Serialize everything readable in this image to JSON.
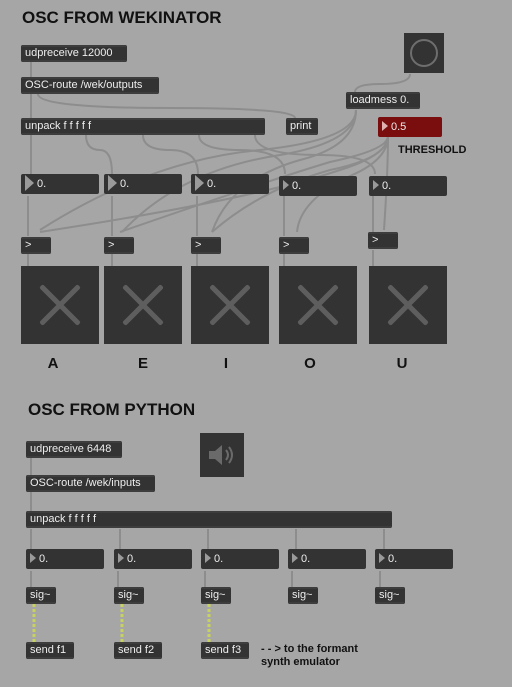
{
  "headings": {
    "wekinator": "OSC FROM WEKINATOR",
    "python": "OSC FROM PYTHON"
  },
  "top": {
    "udpreceive": "udpreceive 12000",
    "osc_route": "OSC-route /wek/outputs",
    "unpack": "unpack f f f f f",
    "print": "print",
    "loadmess": "loadmess 0.",
    "threshold_value": "0.5",
    "threshold_label": "THRESHOLD",
    "number_boxes": [
      "0.",
      "0.",
      "0.",
      "0.",
      "0."
    ],
    "compare_ops": [
      ">",
      ">",
      ">",
      ">",
      ">"
    ],
    "vowels": [
      "A",
      "E",
      "I",
      "O",
      "U"
    ],
    "bang_icon": "bang-circle-icon"
  },
  "bottom": {
    "udpreceive": "udpreceive 6448",
    "osc_route": "OSC-route /wek/inputs",
    "unpack": "unpack f f f f f",
    "number_boxes": [
      "0.",
      "0.",
      "0.",
      "0.",
      "0."
    ],
    "sig_objects": [
      "sig~",
      "sig~",
      "sig~",
      "sig~",
      "sig~"
    ],
    "send_objects": [
      "send f1",
      "send f2",
      "send f3"
    ],
    "dac_icon": "speaker-icon",
    "comment_line1": "- - > to the formant",
    "comment_line2": "synth emulator"
  },
  "colors": {
    "background": "#a6a6a6",
    "object": "#333333",
    "threshold_box": "#7a0d0d",
    "signal_wire": "#c9d65a",
    "patch_wire": "#8a8a8a"
  }
}
